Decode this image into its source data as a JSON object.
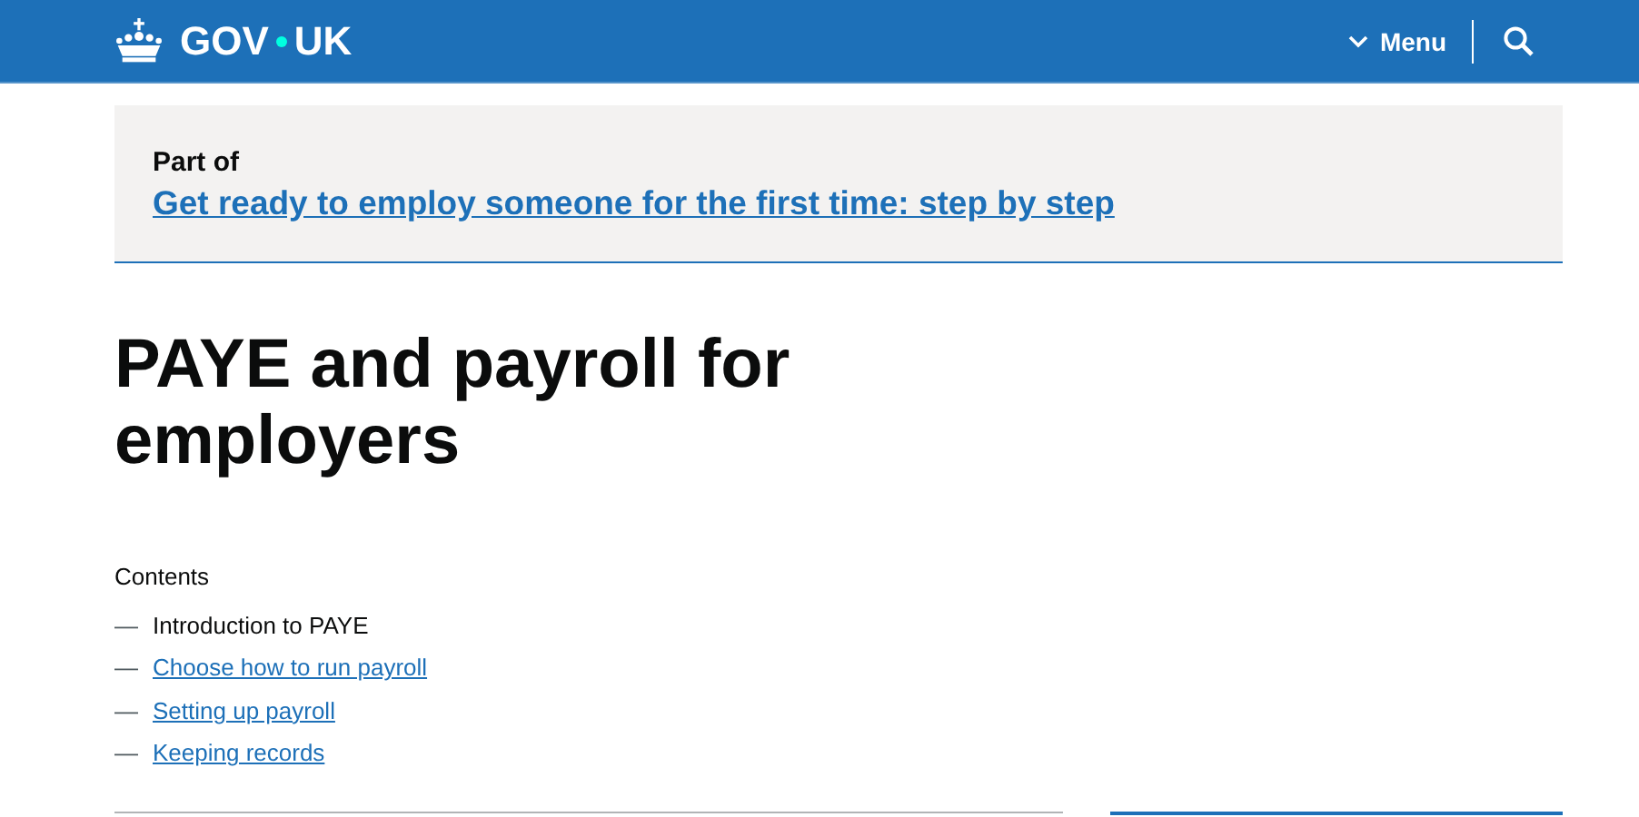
{
  "header": {
    "logo": {
      "left": "GOV",
      "right": "UK"
    },
    "menu": "Menu"
  },
  "step_by_step": {
    "label": "Part of",
    "link": "Get ready to employ someone for the first time: step by step"
  },
  "title": "PAYE and payroll for employers",
  "contents": {
    "heading": "Contents",
    "items": [
      {
        "marker": "—",
        "text": "Introduction to PAYE",
        "selected": true
      },
      {
        "marker": "—",
        "text": "Choose how to run payroll",
        "selected": false
      },
      {
        "marker": "—",
        "text": "Setting up payroll",
        "selected": false
      },
      {
        "marker": "—",
        "text": "Keeping records",
        "selected": false
      }
    ]
  }
}
